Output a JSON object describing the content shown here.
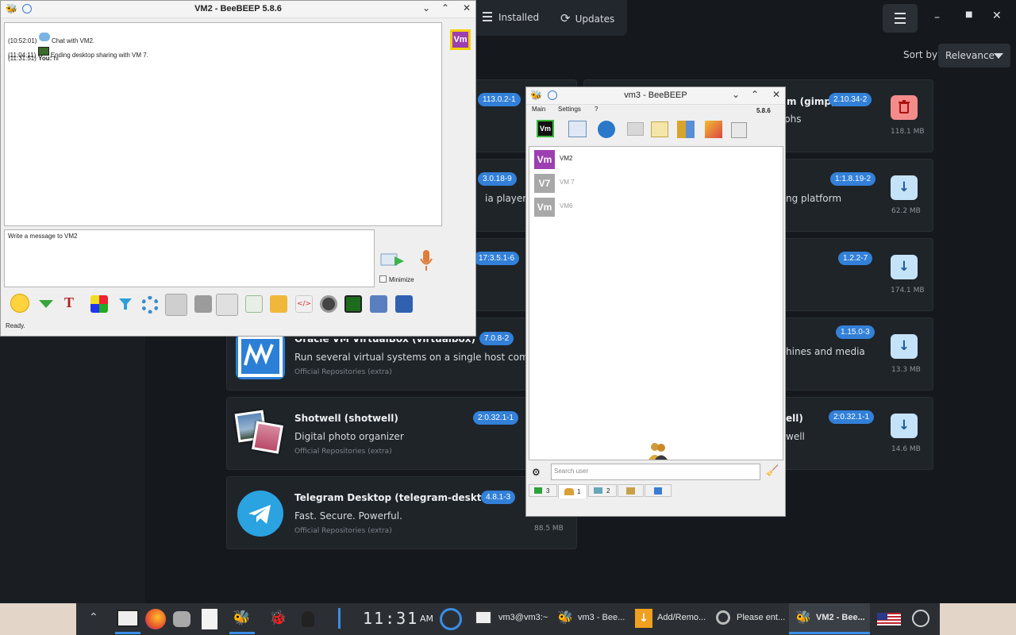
{
  "app": {
    "tabs": [
      {
        "label": "Installed",
        "icon": "list-icon"
      },
      {
        "label": "Updates",
        "icon": "refresh-icon"
      }
    ],
    "sort_label": "Sort by",
    "sort_value": "Relevance",
    "colors": {
      "accent": "#3280d8",
      "bg": "#15191d",
      "card": "#1f2429"
    },
    "cards": [
      {
        "version": "113.0.2-1"
      },
      {
        "version": "3.0.18-9",
        "desc": "ia player"
      },
      {
        "version": "17:3.5.1-6"
      },
      {
        "title": "Oracle VM VirtualBox (virtualbox)",
        "version": "7.0.8-2",
        "desc": "Run several virtual systems on a single host computer",
        "repo": "Official Repositories (extra)"
      },
      {
        "title": "Shotwell (shotwell)",
        "version": "2:0.32.1-1",
        "desc": "Digital photo organizer",
        "repo": "Official Repositories (extra)"
      },
      {
        "title": "Telegram Desktop (telegram-desktop)",
        "version": "4.8.1-3",
        "desc": "Fast. Secure. Powerful.",
        "repo": "Official Repositories (extra)",
        "size": "88.5 MB"
      }
    ],
    "right_cards": [
      {
        "title": "m (gimp)",
        "version": "2.10.34-2",
        "desc": "phs",
        "size": "118.1 MB",
        "action": "remove"
      },
      {
        "version": "1:1.8.19-2",
        "desc": "ng platform",
        "size": "62.2 MB",
        "action": "download"
      },
      {
        "version": "1.2.2-7",
        "size": "174.1 MB",
        "action": "download"
      },
      {
        "version": "1.15.0-3",
        "desc": "hines and media",
        "size": "13.3 MB",
        "action": "download"
      },
      {
        "title": "ell)",
        "version": "2:0.32.1-1",
        "desc": "well",
        "size": "14.6 MB",
        "action": "download"
      }
    ]
  },
  "chat_window": {
    "title": "VM2 - BeeBEEP 5.8.6",
    "avatar": "Vm",
    "messages": [
      {
        "time": "(10:52:01)",
        "text": "Chat with VM2."
      },
      {
        "time": "(11:04:11)",
        "text": "Ending desktop sharing with VM 7."
      },
      {
        "time": "(11:31:51)",
        "sender": "You:",
        "text": "hi"
      }
    ],
    "input_placeholder": "Write a message to VM2",
    "minimize_label": "Minimize",
    "status": "Ready."
  },
  "main_window": {
    "title": "vm3 - BeeBEEP",
    "menu": [
      "Main",
      "Settings",
      "?"
    ],
    "version": "5.8.6",
    "users": [
      {
        "avatar": "Vm",
        "name": "VM2",
        "color": "#9c3fb0",
        "online": true
      },
      {
        "avatar": "V7",
        "name": "VM 7",
        "color": "#a8a8a8",
        "online": false
      },
      {
        "avatar": "Vm",
        "name": "VM6",
        "color": "#a8a8a8",
        "online": false
      }
    ],
    "search_placeholder": "Search user",
    "tabs": [
      {
        "count": "3"
      },
      {
        "count": "1"
      },
      {
        "count": "2"
      },
      {
        "count": ""
      },
      {
        "count": ""
      }
    ]
  },
  "taskbar": {
    "clock": "11:31",
    "clock_ampm": "AM",
    "items": [
      {
        "label": "vm3@vm3:~"
      },
      {
        "label": "vm3 - Bee..."
      },
      {
        "label": "Add/Remo..."
      },
      {
        "label": "Please ent..."
      },
      {
        "label": "VM2 - Bee..."
      }
    ]
  }
}
